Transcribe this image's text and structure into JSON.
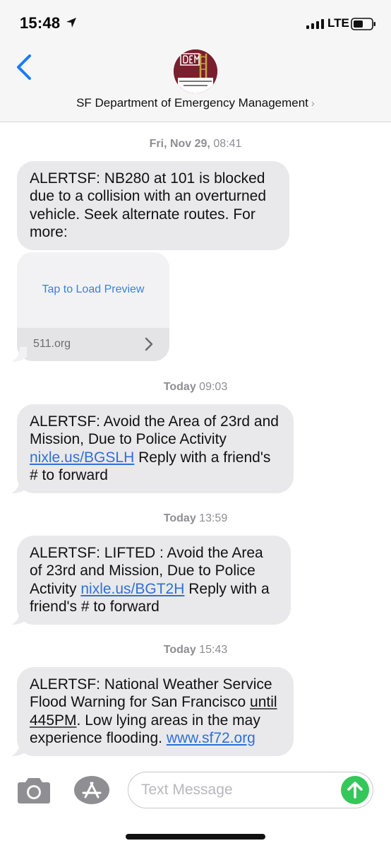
{
  "status_bar": {
    "time": "15:48",
    "network": "LTE"
  },
  "header": {
    "contact_name": "SF Department of Emergency Management",
    "chevron": "›"
  },
  "messages": [
    {
      "stamp_day": "Fri, Nov 29,",
      "stamp_time": "08:41",
      "text": "ALERTSF: NB280 at 101 is blocked due to a collision with an overturned vehicle. Seek alternate routes. For more:"
    },
    {
      "preview_tap": "Tap to Load Preview",
      "preview_domain": "511.org"
    },
    {
      "stamp_day": "Today",
      "stamp_time": "09:03",
      "text_before": "ALERTSF: Avoid the Area of 23rd and Mission, Due to Police Activity ",
      "link": "nixle.us/BGSLH",
      "text_after": " Reply with a friend's # to forward"
    },
    {
      "stamp_day": "Today",
      "stamp_time": "13:59",
      "text_before": "ALERTSF: LIFTED : Avoid the Area of 23rd and Mission, Due to Police Activity ",
      "link": "nixle.us/BGT2H",
      "text_after": " Reply with a friend's # to forward"
    },
    {
      "stamp_day": "Today",
      "stamp_time": "15:43",
      "text_before": "ALERTSF: National Weather Service Flood Warning for San Francisco ",
      "underlined": "until 445PM",
      "text_middle": ". Low lying areas in the may experience flooding. ",
      "link": "www.sf72.org"
    }
  ],
  "composer": {
    "placeholder": "Text Message"
  },
  "icons": {
    "back": "chevron-left-icon",
    "camera": "camera-icon",
    "app_store": "app-store-icon",
    "send": "send-arrow-icon",
    "avatar": "dem-logo"
  },
  "colors": {
    "bubble": "#e9e9eb",
    "link": "#2f70d7",
    "accent": "#1a7cf6",
    "send": "#34c759",
    "avatar": "#7a1f2e"
  }
}
